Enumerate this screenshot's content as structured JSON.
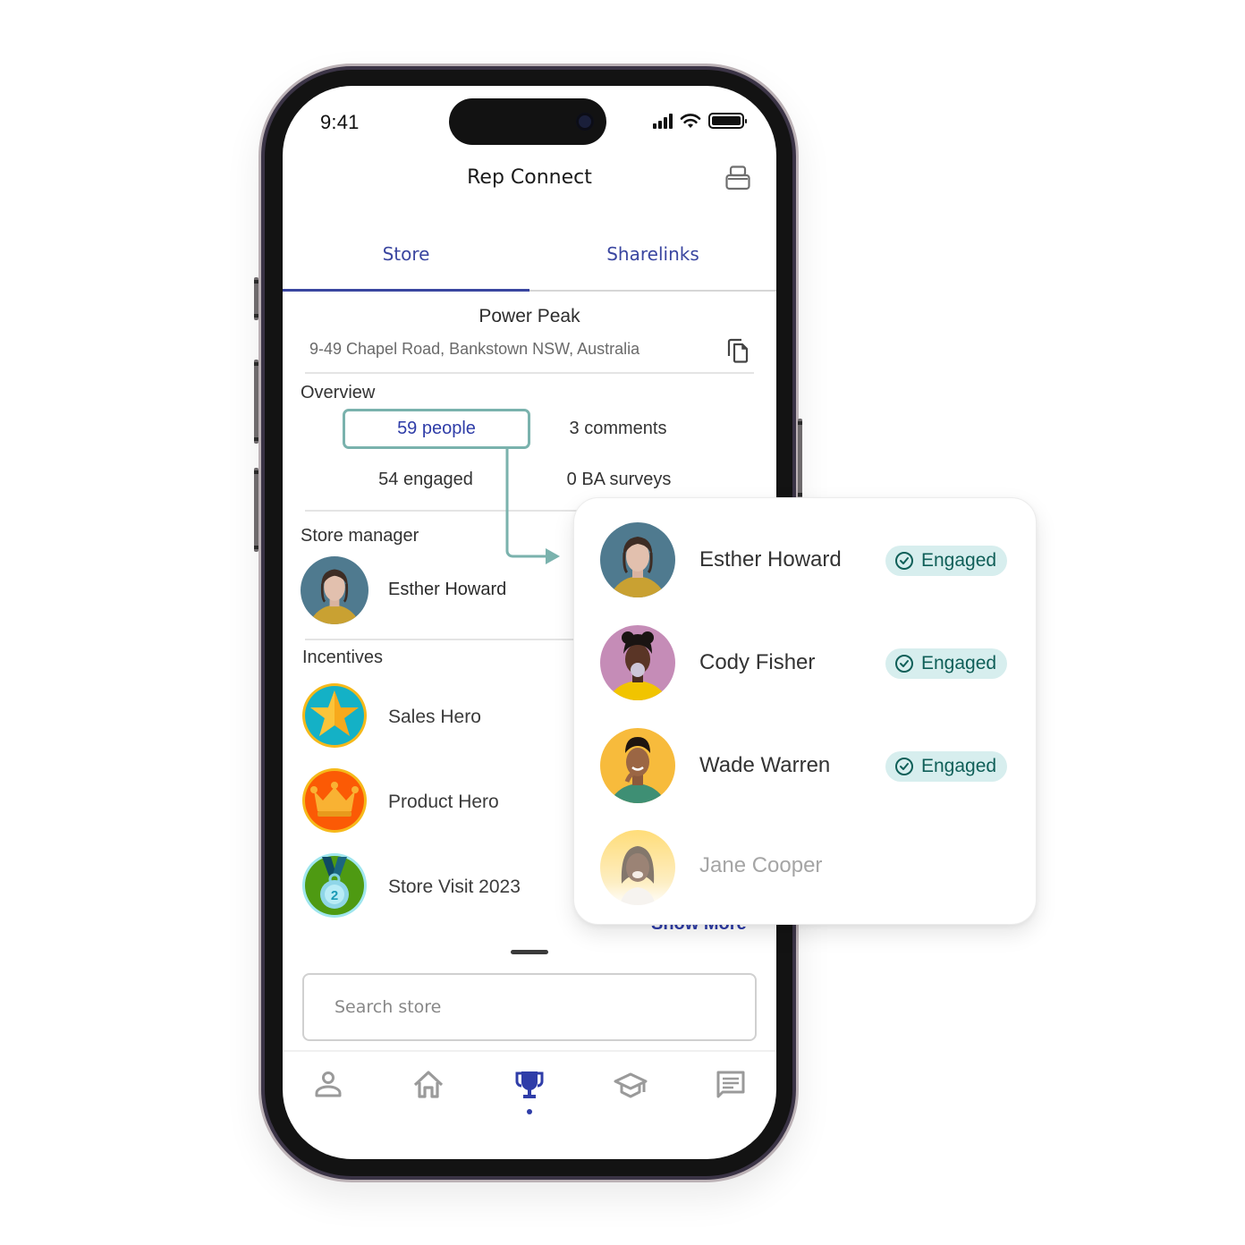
{
  "status_bar": {
    "time": "9:41"
  },
  "header": {
    "title": "Rep Connect",
    "action_icon": "store-bag-icon"
  },
  "tabs": [
    {
      "label": "Store",
      "active": true
    },
    {
      "label": "Sharelinks",
      "active": false
    }
  ],
  "store": {
    "name": "Power Peak",
    "address": "9-49 Chapel Road, Bankstown NSW, Australia",
    "copy_icon": "copy-icon"
  },
  "overview": {
    "label": "Overview",
    "people": "59 people",
    "comments": "3 comments",
    "engaged": "54 engaged",
    "surveys": "0 BA surveys"
  },
  "store_manager": {
    "label": "Store manager",
    "name": "Esther Howard"
  },
  "incentives": {
    "label": "Incentives",
    "items": [
      {
        "label": "Sales Hero",
        "icon": "star-badge-icon"
      },
      {
        "label": "Product Hero",
        "icon": "crown-badge-icon"
      },
      {
        "label": "Store Visit 2023",
        "icon": "medal-badge-icon",
        "medal_number": "2"
      }
    ],
    "show_more": "Show More"
  },
  "search": {
    "placeholder": "Search store"
  },
  "bottom_nav": [
    {
      "name": "profile",
      "icon": "person-icon",
      "active": false
    },
    {
      "name": "home",
      "icon": "home-icon",
      "active": false
    },
    {
      "name": "rewards",
      "icon": "trophy-icon",
      "active": true
    },
    {
      "name": "learning",
      "icon": "graduation-cap-icon",
      "active": false
    },
    {
      "name": "messages",
      "icon": "chat-icon",
      "active": false
    }
  ],
  "people_popup": {
    "people": [
      {
        "name": "Esther Howard",
        "status": "Engaged",
        "engaged": true
      },
      {
        "name": "Cody Fisher",
        "status": "Engaged",
        "engaged": true
      },
      {
        "name": "Wade Warren",
        "status": "Engaged",
        "engaged": true
      },
      {
        "name": "Jane Cooper",
        "status": "",
        "engaged": false
      }
    ]
  },
  "colors": {
    "brand_blue": "#2f3da8",
    "teal_accent": "#7ab2ad",
    "engaged_bg": "#d7eeee",
    "engaged_text": "#0f5f58"
  }
}
